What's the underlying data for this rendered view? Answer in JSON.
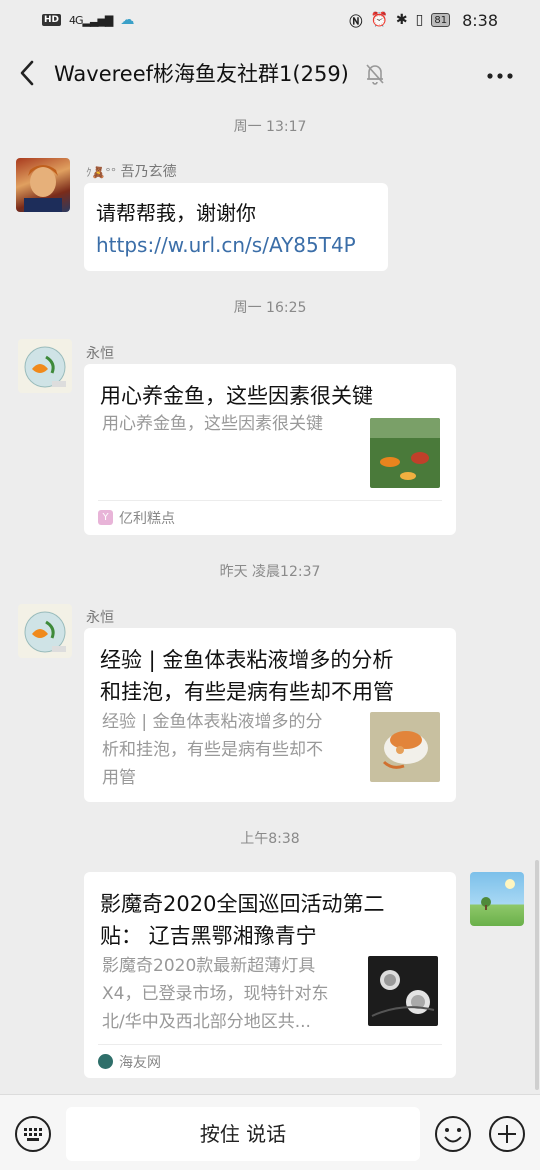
{
  "status_bar": {
    "hd": "HD",
    "network": "4G",
    "battery": "81",
    "time": "8:38"
  },
  "header": {
    "title": "Wavereef彬海鱼友社群1(259)"
  },
  "messages": [
    {
      "timestamp": "周一 13:17",
      "sender": "吾乃玄德",
      "sender_prefix": "ｸ🧸°°",
      "text": "请帮帮莪，谢谢你",
      "link": "https://w.url.cn/s/AY85T4P"
    },
    {
      "timestamp": "周一 16:25",
      "sender": "永恒",
      "card_title": "用心养金鱼，这些因素很关键",
      "card_desc": "用心养金鱼，这些因素很关键",
      "source": "亿利糕点"
    },
    {
      "timestamp": "昨天 凌晨12:37",
      "sender": "永恒",
      "card_title": "经验 | 金鱼体表粘液增多的分析和挂泡，有些是病有些却不用管",
      "card_title_lines": [
        "经验 | 金鱼体表粘液增多的分析",
        "和挂泡，有些是病有些却不用管"
      ],
      "card_desc_lines": [
        "经验 | 金鱼体表粘液增多的分",
        "析和挂泡，有些是病有些却不",
        "用管"
      ]
    },
    {
      "timestamp": "上午8:38",
      "card_title_lines": [
        "影魔奇2020全国巡回活动第二",
        "贴： 辽吉黑鄂湘豫青宁"
      ],
      "card_desc_lines": [
        "影魔奇2020款最新超薄灯具",
        "X4，已登录市场，现特针对东",
        "北/华中及西北部分地区共..."
      ],
      "source": "海友网"
    }
  ],
  "input_bar": {
    "hold_to_talk": "按住 说话"
  }
}
